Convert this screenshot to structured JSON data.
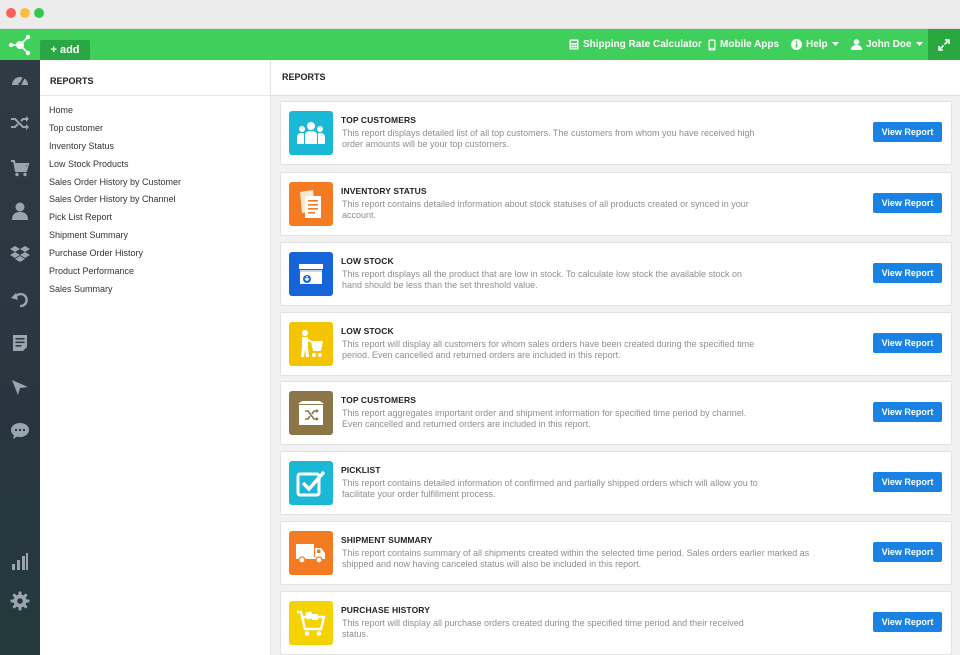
{
  "window": {
    "controls": [
      "close",
      "minimize",
      "maximize"
    ]
  },
  "topbar": {
    "add_label": "+ add",
    "links": {
      "shipping": "Shipping Rate Calculator",
      "mobile": "Mobile Apps",
      "help": "Help",
      "user": "John Doe"
    },
    "colors": {
      "bar": "#40cf5b",
      "add": "#2aa744",
      "expand": "#28a83e"
    }
  },
  "rail": {
    "icons": [
      "dashboard-icon",
      "shuffle-icon",
      "cart-icon",
      "user-icon",
      "dropbox-icon",
      "undo-icon",
      "invoice-icon",
      "send-icon",
      "chat-icon",
      "bar-chart-icon",
      "gear-icon"
    ]
  },
  "sidebar": {
    "title": "REPORTS",
    "items": [
      "Home",
      "Top customer",
      "Inventory Status",
      "Low Stock Products",
      "Sales Order History by Customer",
      "Sales Order History by Channel",
      "Pick List Report",
      "Shipment Summary",
      "Purchase Order History",
      "Product Performance",
      "Sales Summary"
    ]
  },
  "main": {
    "title": "REPORTS",
    "button_label": "View Report",
    "cards": [
      {
        "title": "TOP CUSTOMERS",
        "desc": "This report displays detailed list of all top customers. The customers from whom you have received high order amounts will be your top customers.",
        "icon": "people-icon",
        "color": "#1ab8d4"
      },
      {
        "title": "INVENTORY STATUS",
        "desc": "This report contains detailed information about stock statuses of all products created or synced in your account.",
        "icon": "documents-icon",
        "color": "#f47b22"
      },
      {
        "title": "LOW STOCK",
        "desc": "This report displays all the product that are low in stock. To calculate low stock the available stock on hand should be less than the set threshold value.",
        "icon": "stock-box-icon",
        "color": "#1565d8"
      },
      {
        "title": "LOW STOCK",
        "desc": "This report will display all customers for whom sales orders have been created during the specified time period. Even cancelled and returned orders are included in this report.",
        "icon": "customer-cart-icon",
        "color": "#f5c400"
      },
      {
        "title": "TOP CUSTOMERS",
        "desc": "This report aggregates important order and shipment information for specified time period by channel. Even cancelled and returned orders are included in this report.",
        "icon": "shuffle-box-icon",
        "color": "#8c7648"
      },
      {
        "title": "PICKLIST",
        "desc": "This report contains detailed information of confirmed and partially shipped orders which will allow you to facilitate your order fulfillment process.",
        "icon": "checkbox-icon",
        "color": "#1ab8d4"
      },
      {
        "title": "SHIPMENT SUMMARY",
        "desc": "This report contains summary of all shipments created within the selected time period. Sales orders earlier marked as shipped and now having canceled status will also be included in this report.",
        "icon": "truck-icon",
        "color": "#f47b22"
      },
      {
        "title": "PURCHASE HISTORY",
        "desc": "This report will display all purchase orders created during the specified time period and their received status.",
        "icon": "purchase-cart-icon",
        "color": "#f5d300"
      }
    ]
  }
}
